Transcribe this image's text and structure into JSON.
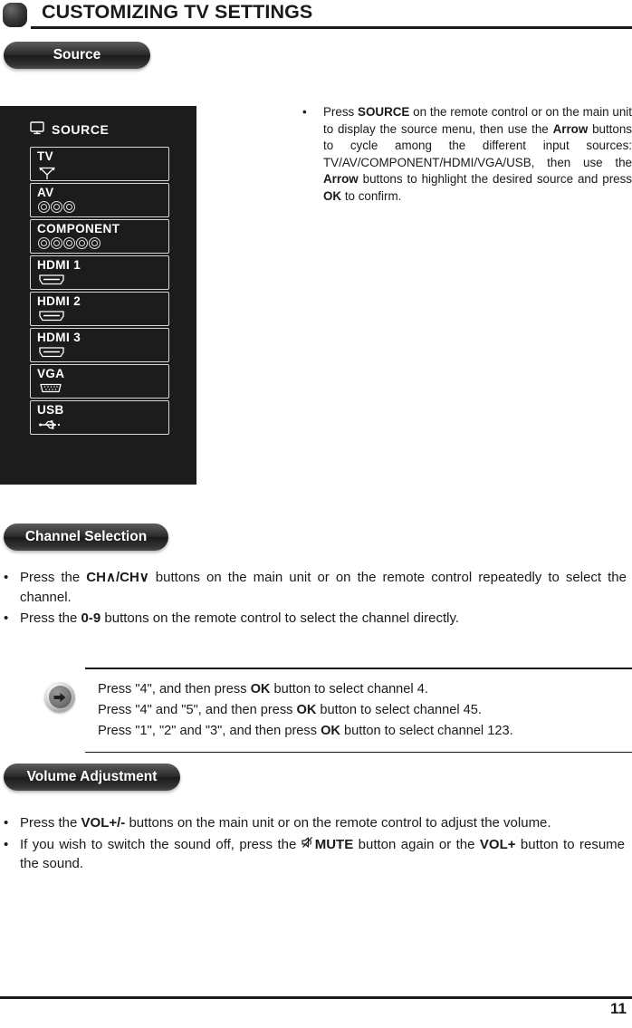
{
  "header": {
    "title": "CUSTOMIZING TV SETTINGS",
    "badge_icon": "rounded-square-badge"
  },
  "sections": {
    "source": {
      "pill_label": "Source"
    },
    "channel": {
      "pill_label": "Channel Selection"
    },
    "volume": {
      "pill_label": "Volume Adjustment"
    }
  },
  "source_panel": {
    "heading": "SOURCE",
    "heading_icon": "monitor-icon",
    "items": [
      {
        "label": "TV",
        "icon": "antenna-icon"
      },
      {
        "label": "AV",
        "icon": "rca-jacks-3-icon"
      },
      {
        "label": "COMPONENT",
        "icon": "rca-jacks-5-icon"
      },
      {
        "label": "HDMI 1",
        "icon": "hdmi-connector-icon"
      },
      {
        "label": "HDMI 2",
        "icon": "hdmi-connector-icon"
      },
      {
        "label": "HDMI 3",
        "icon": "hdmi-connector-icon"
      },
      {
        "label": "VGA",
        "icon": "vga-connector-icon"
      },
      {
        "label": "USB",
        "icon": "usb-icon"
      }
    ]
  },
  "source_instruction": {
    "bullet": "•",
    "part1": "Press ",
    "bold1": "SOURCE",
    "part2": " on the remote control or on the main unit to display the source menu, then use the ",
    "bold2": "Arrow",
    "part3": " buttons to cycle among the different input sources: TV/AV/COMPONENT/HDMI/VGA/USB, then use the ",
    "bold3": "Arrow",
    "part4": " buttons to highlight the desired source and press ",
    "bold4": "OK",
    "part5": " to confirm."
  },
  "channel_bullets": [
    {
      "dot": "•",
      "part1": "Press the ",
      "bold1": "CH",
      "glyph1": "∧",
      "bold2": "/CH",
      "glyph2": "∨",
      "part2": " buttons on the main unit or on the remote control repeatedly to select the channel."
    },
    {
      "dot": "•",
      "part1": "Press the ",
      "bold1": "0-9",
      "part2": " buttons on the remote control to select the channel directly."
    }
  ],
  "note": {
    "icon": "arrow-right-circle-icon",
    "lines": [
      {
        "pre": "Press \"4\", and then press ",
        "bold": "OK",
        "post": " button to select channel 4."
      },
      {
        "pre": "Press \"4\" and \"5\", and then press ",
        "bold": "OK",
        "post": " button to select channel 45."
      },
      {
        "pre": "Press \"1\", \"2\" and \"3\", and then press ",
        "bold": "OK",
        "post": " button to select channel 123."
      }
    ]
  },
  "volume_bullets": [
    {
      "dot": "•",
      "part1": "Press the ",
      "bold1": "VOL+/-",
      "part2": " buttons on the main unit or on the remote control to adjust the volume."
    },
    {
      "dot": "•",
      "part1": "If you wish to switch the sound off, press the ",
      "icon": "mute-speaker-icon",
      "bold1": "MUTE",
      "part2": " button again or the ",
      "bold2": "VOL+",
      "part3": " button to resume the sound."
    }
  ],
  "footer": {
    "page_number": "11"
  },
  "colors": {
    "panel_background": "#1c1c1c",
    "text": "#1a1a1a",
    "panel_text": "#ffffff",
    "rule": "#1a1a1a"
  }
}
